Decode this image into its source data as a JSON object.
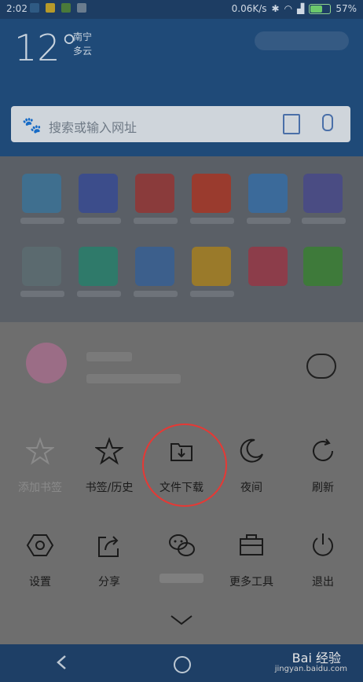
{
  "status_bar": {
    "time": "2:02",
    "network_speed": "0.06K/s",
    "battery_percent": "57%",
    "battery_level": 0.57
  },
  "browser_top": {
    "temperature": "12°",
    "city": "南宁",
    "weather": "多云",
    "search_placeholder": "搜索或输入网址"
  },
  "menu_row1": [
    {
      "label": "添加书签",
      "icon": "star-plus-icon"
    },
    {
      "label": "书签/历史",
      "icon": "star-icon"
    },
    {
      "label": "文件下载",
      "icon": "download-folder-icon"
    },
    {
      "label": "夜间",
      "icon": "moon-icon"
    },
    {
      "label": "刷新",
      "icon": "refresh-icon"
    }
  ],
  "menu_row2": [
    {
      "label": "设置",
      "icon": "hexagon-settings-icon"
    },
    {
      "label": "分享",
      "icon": "share-icon"
    },
    {
      "label": "",
      "icon": "wechat-icon"
    },
    {
      "label": "更多工具",
      "icon": "toolbox-icon"
    },
    {
      "label": "退出",
      "icon": "power-icon"
    }
  ],
  "watermark": {
    "brand": "Bai 经验",
    "domain": "jingyan.baidu.com"
  },
  "colors": {
    "highlight": "#e53935",
    "panel_bg": "#6e6e6e",
    "top_bg": "#1f4a78"
  }
}
